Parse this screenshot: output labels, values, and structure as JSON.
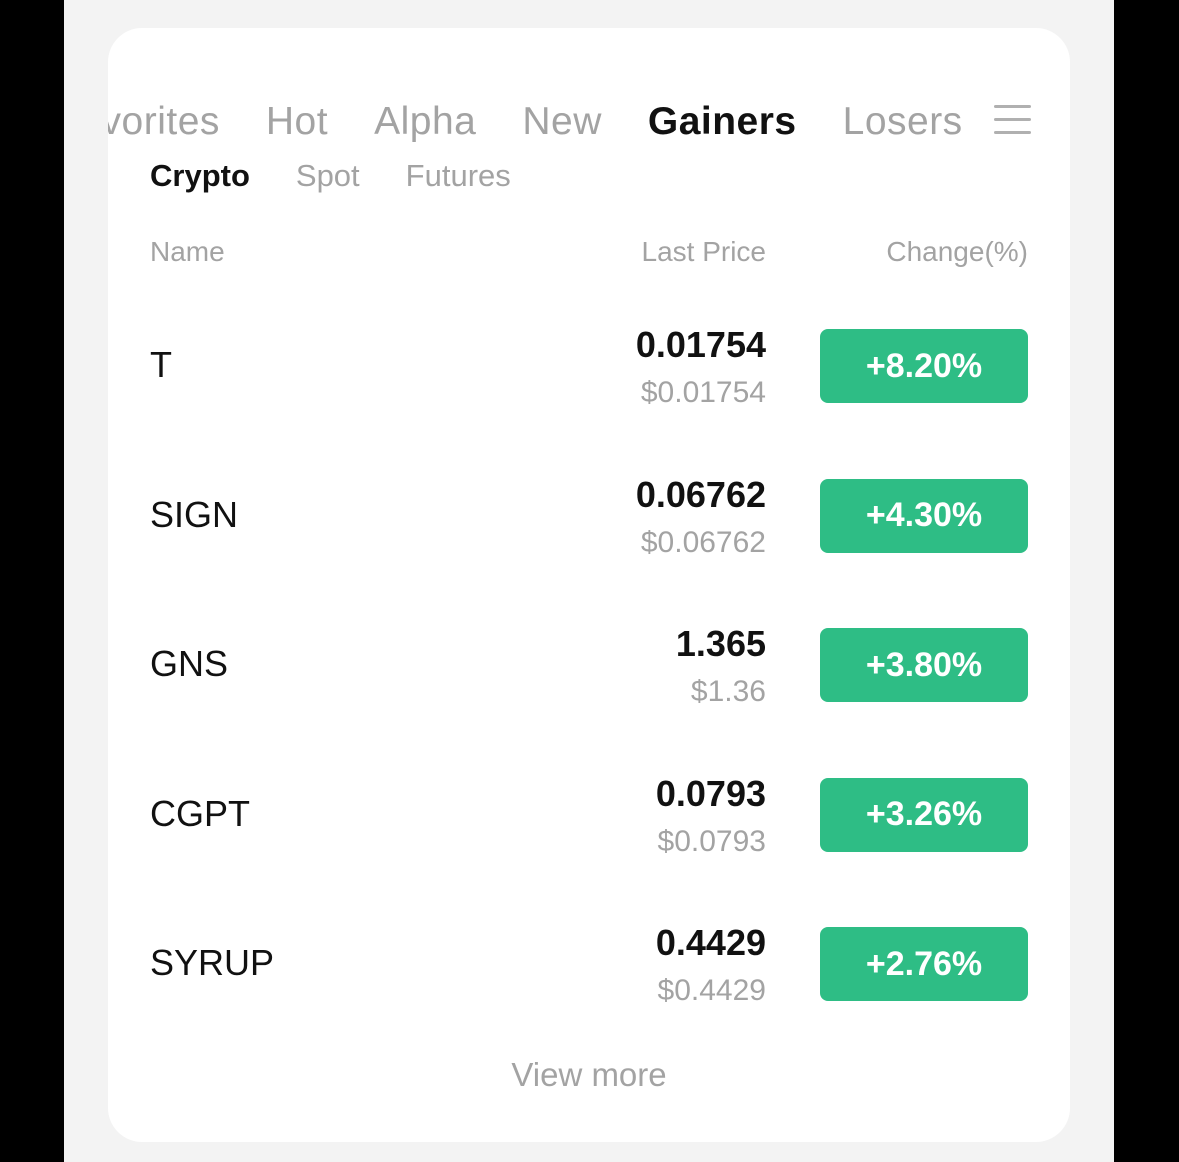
{
  "colors": {
    "accent_green": "#2ebd85",
    "text_primary": "#111111",
    "text_secondary": "#a3a3a3",
    "card_bg": "#ffffff",
    "page_bg": "#f3f3f3"
  },
  "tabs": [
    {
      "label": "Favorites"
    },
    {
      "label": "Hot"
    },
    {
      "label": "Alpha"
    },
    {
      "label": "New"
    },
    {
      "label": "Gainers"
    },
    {
      "label": "Losers"
    }
  ],
  "active_tab": "Gainers",
  "menu_icon": "hamburger-menu-icon",
  "subtabs": [
    {
      "label": "Crypto"
    },
    {
      "label": "Spot"
    },
    {
      "label": "Futures"
    }
  ],
  "active_subtab": "Crypto",
  "columns": {
    "name": "Name",
    "last_price": "Last Price",
    "change": "Change(%)"
  },
  "rows": [
    {
      "name": "T",
      "price": "0.01754",
      "usd": "$0.01754",
      "change": "+8.20%"
    },
    {
      "name": "SIGN",
      "price": "0.06762",
      "usd": "$0.06762",
      "change": "+4.30%"
    },
    {
      "name": "GNS",
      "price": "1.365",
      "usd": "$1.36",
      "change": "+3.80%"
    },
    {
      "name": "CGPT",
      "price": "0.0793",
      "usd": "$0.0793",
      "change": "+3.26%"
    },
    {
      "name": "SYRUP",
      "price": "0.4429",
      "usd": "$0.4429",
      "change": "+2.76%"
    }
  ],
  "view_more": "View more"
}
